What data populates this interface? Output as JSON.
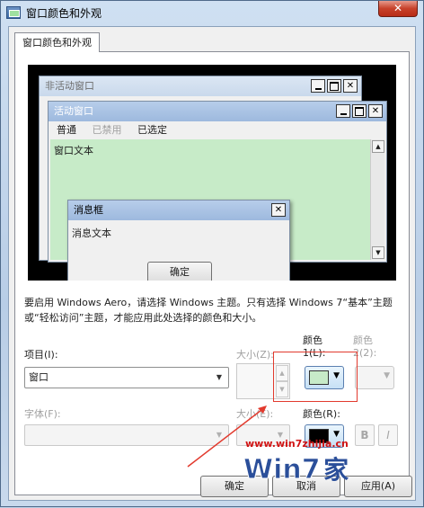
{
  "window": {
    "title": "窗口颜色和外观",
    "close_symbol": "✕"
  },
  "tab": {
    "label": "窗口颜色和外观"
  },
  "preview": {
    "inactive_title": "非活动窗口",
    "active_title": "活动窗口",
    "menu": {
      "normal": "普通",
      "disabled": "已禁用",
      "selected": "已选定"
    },
    "window_text": "窗口文本",
    "msgbox_title": "消息框",
    "msgbox_text": "消息文本",
    "ok_label": "确定",
    "window_text_bg": "#c7ebc8"
  },
  "note": "要启用 Windows Aero，请选择 Windows 主题。只有选择 Windows 7“基本”主题或“轻松访问”主题，才能应用此处选择的颜色和大小。",
  "item": {
    "label": "项目(I):",
    "value": "窗口",
    "size_label": "大小(Z):",
    "color1_label_top": "颜色",
    "color1_label_bottom": "1(L):",
    "color2_label_top": "颜色",
    "color2_label_bottom": "2(2):",
    "color1_value": "#c7ebc8"
  },
  "font": {
    "label": "字体(F):",
    "value": "",
    "size_label": "大小(E):",
    "color_label": "颜色(R):",
    "color_value": "#000000",
    "bold_label": "B",
    "italic_label": "I"
  },
  "footer": {
    "ok": "确定",
    "cancel": "取消",
    "apply": "应用(A)"
  },
  "watermark": {
    "url": "www.win7zhijia.cn",
    "logo_text": "Win7",
    "logo_suffix": "家"
  },
  "colors": {
    "annotation": "#e23a2e",
    "accent": "#5a7fb0"
  }
}
